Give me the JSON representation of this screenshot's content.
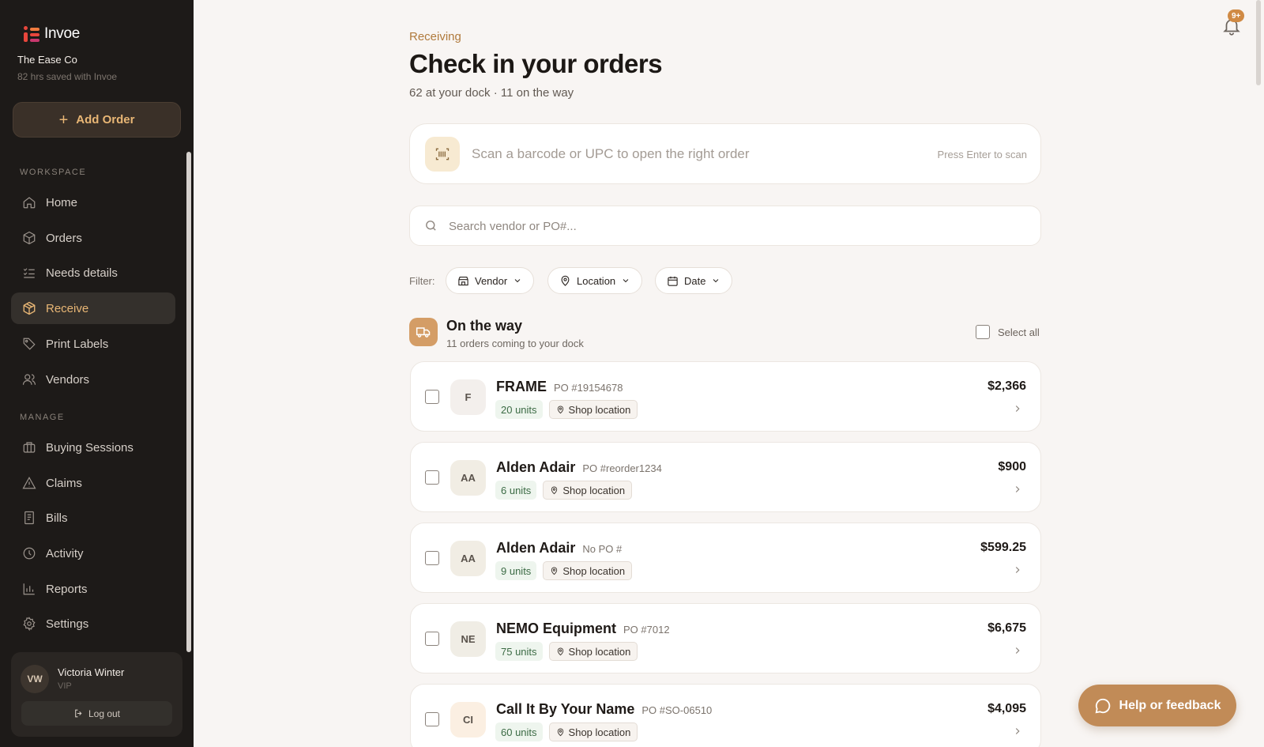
{
  "sidebar": {
    "logo_text": "Invoe",
    "company": "The Ease Co",
    "saved": "82 hrs saved with Invoe",
    "add_order": "Add Order",
    "workspace_label": "WORKSPACE",
    "manage_label": "MANAGE",
    "workspace_items": [
      {
        "label": "Home",
        "icon": "home-icon"
      },
      {
        "label": "Orders",
        "icon": "box-icon"
      },
      {
        "label": "Needs details",
        "icon": "checklist-icon"
      },
      {
        "label": "Receive",
        "icon": "package-icon",
        "active": true
      },
      {
        "label": "Print Labels",
        "icon": "tag-icon"
      },
      {
        "label": "Vendors",
        "icon": "users-icon"
      }
    ],
    "manage_items": [
      {
        "label": "Buying Sessions",
        "icon": "briefcase-icon"
      },
      {
        "label": "Claims",
        "icon": "warning-icon"
      },
      {
        "label": "Bills",
        "icon": "receipt-icon"
      },
      {
        "label": "Activity",
        "icon": "clock-icon"
      },
      {
        "label": "Reports",
        "icon": "bar-chart-icon"
      },
      {
        "label": "Settings",
        "icon": "gear-icon"
      }
    ],
    "user": {
      "initials": "VW",
      "name": "Victoria Winter",
      "role": "VIP",
      "logout": "Log out"
    }
  },
  "header": {
    "eyebrow": "Receiving",
    "title": "Check in your orders",
    "subtitle": "62 at your dock · 11 on the way",
    "notifications_badge": "9+"
  },
  "scan": {
    "placeholder": "Scan a barcode or UPC to open the right order",
    "hint": "Press Enter to scan"
  },
  "search": {
    "placeholder": "Search vendor or PO#..."
  },
  "filters": {
    "label": "Filter:",
    "items": [
      {
        "label": "Vendor",
        "icon": "store-icon"
      },
      {
        "label": "Location",
        "icon": "pin-icon"
      },
      {
        "label": "Date",
        "icon": "calendar-icon"
      }
    ]
  },
  "group": {
    "title": "On the way",
    "subtitle": "11 orders coming to your dock",
    "select_all": "Select all"
  },
  "orders": [
    {
      "initials": "F",
      "vendor": "FRAME",
      "po": "PO #19154678",
      "units": "20 units",
      "location": "Shop location",
      "amount": "$2,366",
      "avatar_bg": "#f3efec"
    },
    {
      "initials": "AA",
      "vendor": "Alden Adair",
      "po": "PO #reorder1234",
      "units": "6 units",
      "location": "Shop location",
      "amount": "$900",
      "avatar_bg": "#f1ede4"
    },
    {
      "initials": "AA",
      "vendor": "Alden Adair",
      "po": "No PO #",
      "units": "9 units",
      "location": "Shop location",
      "amount": "$599.25",
      "avatar_bg": "#f1ede4"
    },
    {
      "initials": "NE",
      "vendor": "NEMO Equipment",
      "po": "PO #7012",
      "units": "75 units",
      "location": "Shop location",
      "amount": "$6,675",
      "avatar_bg": "#f0ede5"
    },
    {
      "initials": "CI",
      "vendor": "Call It By Your Name",
      "po": "PO #SO-06510",
      "units": "60 units",
      "location": "Shop location",
      "amount": "$4,095",
      "avatar_bg": "#fbefe2"
    }
  ],
  "help": {
    "label": "Help or feedback"
  },
  "colors": {
    "accent": "#e8b675",
    "brand_orange": "#d49d66",
    "help_button": "#c18b57",
    "sidebar_bg": "#1d1a18"
  }
}
